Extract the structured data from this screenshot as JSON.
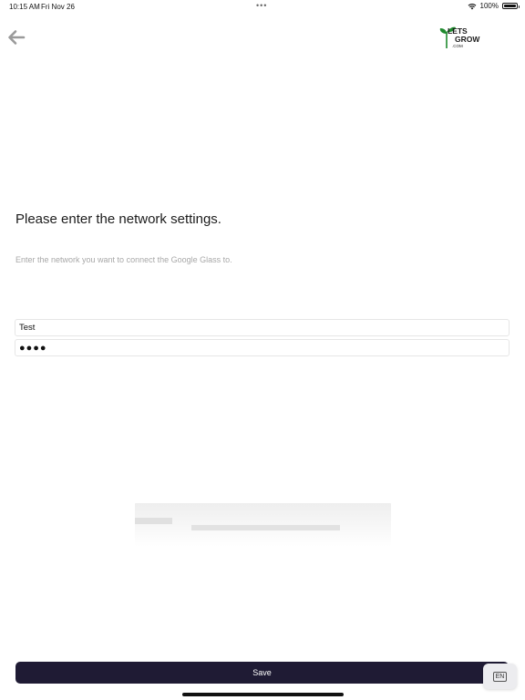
{
  "status_bar": {
    "time": "10:15 AM",
    "date": "Fri Nov 26",
    "battery_text": "100%",
    "battery_level": 1.0,
    "icons": [
      "multitask-dots-icon",
      "wifi-icon",
      "battery-icon"
    ]
  },
  "header": {
    "back_icon": "arrow-left-icon",
    "logo": {
      "line1": "LETS",
      "line2": "GROW",
      "line3": ".COM",
      "accent_color": "#1f8a2e"
    }
  },
  "main": {
    "heading": "Please enter the network settings.",
    "subtext": "Enter the network you want to connect the Google Glass to.",
    "network_name_value": "Test",
    "password_value": "●●●●"
  },
  "footer": {
    "save_label": "Save",
    "save_color": "#1f1b34",
    "language_label": "EN"
  }
}
